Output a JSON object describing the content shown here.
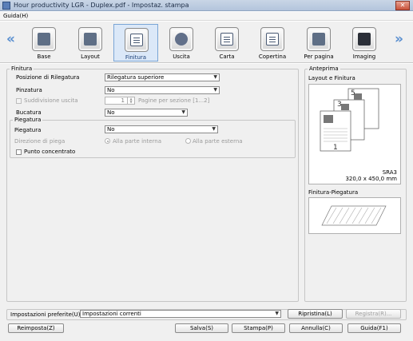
{
  "window": {
    "title": "Hour productivity LGR - Duplex.pdf - Impostaz. stampa",
    "close": "✕"
  },
  "menu": {
    "guida": "Guida(H)"
  },
  "nav": {
    "left": "«",
    "right": "»"
  },
  "tabs": [
    {
      "label": "Base",
      "icon": "base-icon"
    },
    {
      "label": "Layout",
      "icon": "layout-icon"
    },
    {
      "label": "Finitura",
      "icon": "finitura-icon",
      "active": true
    },
    {
      "label": "Uscita",
      "icon": "uscita-icon"
    },
    {
      "label": "Carta",
      "icon": "carta-icon"
    },
    {
      "label": "Copertina",
      "icon": "copertina-icon"
    },
    {
      "label": "Per pagina",
      "icon": "per-pagina-icon"
    },
    {
      "label": "Imaging",
      "icon": "imaging-icon"
    }
  ],
  "finitura": {
    "legend": "Finitura",
    "posizione_label": "Posizione di Rilegatura",
    "posizione_value": "Rilegatura superiore",
    "pinzatura_label": "Pinzatura",
    "pinzatura_value": "No",
    "suddivisione_label": "Suddivisione uscita",
    "suddivisione_value": "1",
    "pagine_label": "Pagine per sezione [1...2]",
    "bucatura_label": "Bucatura",
    "bucatura_value": "No"
  },
  "piegatura": {
    "legend": "Piegatura",
    "piegatura_label": "Piegatura",
    "piegatura_value": "No",
    "direzione_label": "Direzione di piega",
    "interna_label": "Alla parte interna",
    "esterna_label": "Alla parte esterna",
    "punto_label": "Punto concentrato"
  },
  "anteprima": {
    "legend": "Anteprima",
    "layout_label": "Layout e Finitura",
    "paper_name": "SRA3",
    "paper_size": "320,0 x 450,0 mm",
    "page_numbers": [
      "5",
      "3",
      "1"
    ],
    "finitura_piegatura_label": "Finitura-Piegatura"
  },
  "footer": {
    "preferite_label": "Impostazioni preferite(U)",
    "preferite_value": "Impostazioni correnti",
    "ripristina": "Ripristina(L)",
    "registra": "Registra(R)...",
    "reimposta": "Reimposta(Z)",
    "salva": "Salva(S)",
    "stampa": "Stampa(P)",
    "annulla": "Annulla(C)",
    "guida": "Guida(F1)"
  },
  "colors": {
    "accent": "#7aa5d6",
    "active_tab_bg": "#dbe8f8",
    "titlebar": "#c9d6e6"
  }
}
